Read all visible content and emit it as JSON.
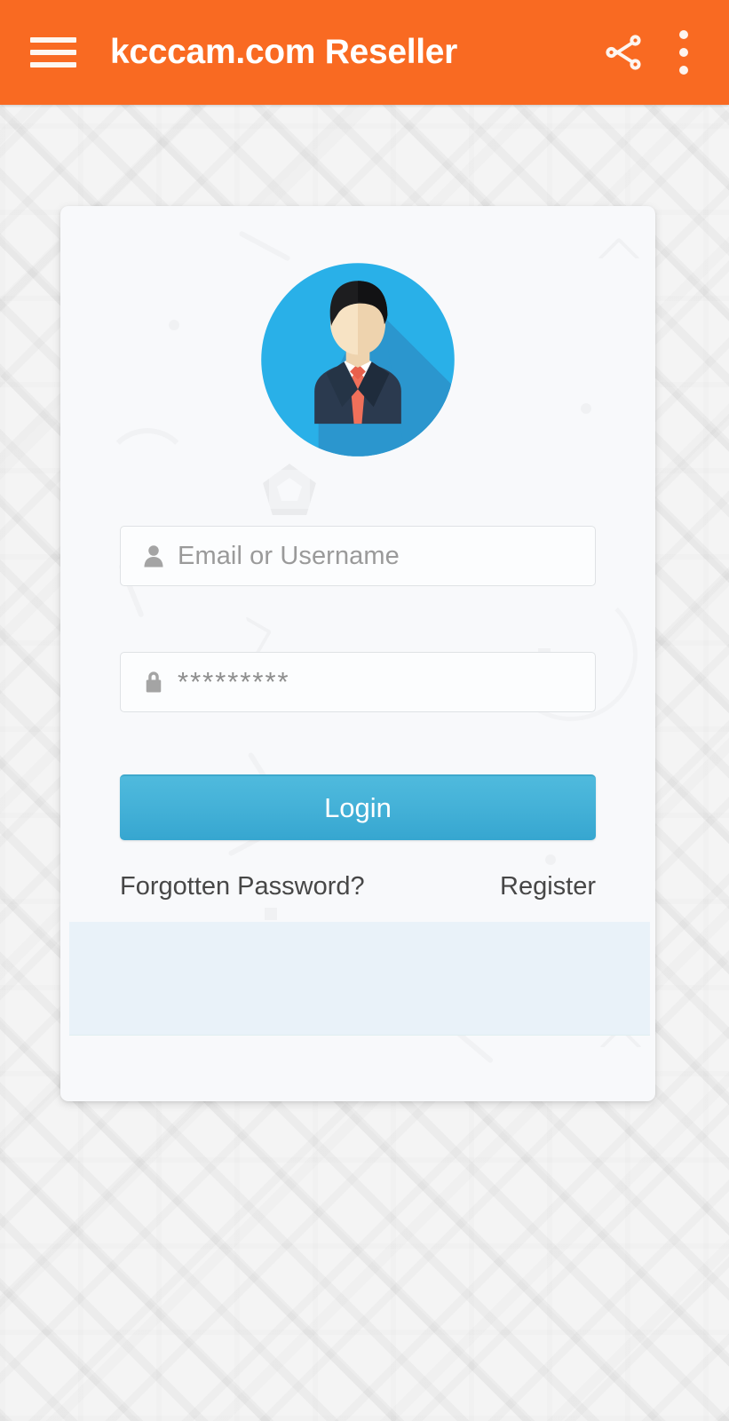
{
  "appbar": {
    "title": "kcccam.com Reseller",
    "menu_icon": "hamburger-menu-icon",
    "share_icon": "share-icon",
    "overflow_icon": "more-vert-icon",
    "background_color": "#f96a22",
    "text_color": "#ffffff"
  },
  "card": {
    "avatar": {
      "icon": "user-avatar-businessman-icon",
      "circle_color": "#29b0e8",
      "shadow_color": "#2b96ce",
      "hair_color": "#1d1d1f",
      "skin_color": "#f7e0c0",
      "suit_color": "#2b3a4f",
      "shirt_color": "#ffffff",
      "tie_color": "#f0705a"
    },
    "fields": [
      {
        "name": "email-or-username",
        "icon": "person-icon",
        "value": "",
        "placeholder": "Email or Username"
      },
      {
        "name": "password",
        "icon": "lock-icon",
        "value": "",
        "placeholder": "*********"
      }
    ],
    "login_button": {
      "label": "Login",
      "color_top": "#4fbadd",
      "color_bottom": "#36a6d0",
      "text_color": "#ffffff"
    },
    "links": {
      "forgotten_password": "Forgotten Password?",
      "register": "Register"
    },
    "background_color": "#f8f9fb"
  },
  "banner": {
    "content": "",
    "background_color": "#e9f2f9"
  },
  "background": {
    "color": "#f4f4f4",
    "pattern": "diagonal-maze-pattern"
  }
}
